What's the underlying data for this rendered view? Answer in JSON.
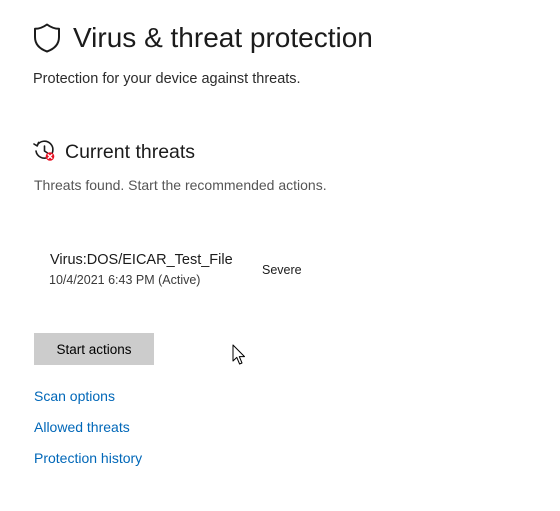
{
  "header": {
    "title": "Virus & threat protection",
    "subtitle": "Protection for your device against threats.",
    "icon": "shield-icon"
  },
  "current_threats": {
    "title": "Current threats",
    "description": "Threats found. Start the recommended actions.",
    "icon": "threat-history-icon",
    "items": [
      {
        "name": "Virus:DOS/EICAR_Test_File",
        "details": "10/4/2021 6:43 PM (Active)",
        "severity": "Severe"
      }
    ],
    "action_button": "Start actions"
  },
  "links": {
    "scan_options": "Scan options",
    "allowed_threats": "Allowed threats",
    "protection_history": "Protection history"
  },
  "colors": {
    "link": "#0067b8",
    "button_bg": "#cccccc",
    "alert_red": "#e81123"
  }
}
